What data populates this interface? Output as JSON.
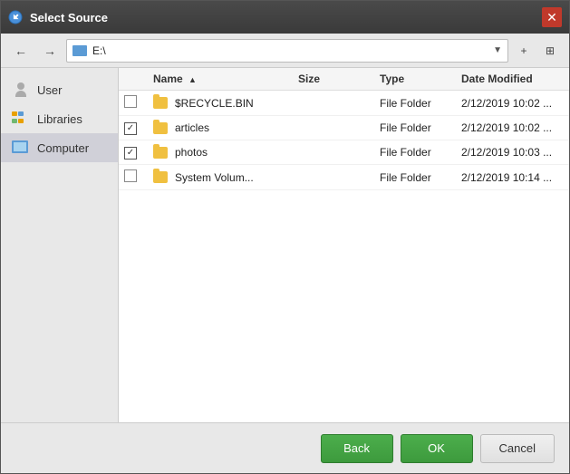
{
  "titleBar": {
    "title": "Select Source",
    "closeLabel": "✕"
  },
  "toolbar": {
    "backLabel": "←",
    "forwardLabel": "→",
    "addressText": "E:\\",
    "dropdownLabel": "▼",
    "newFolderLabel": "+",
    "viewLabel": "⊞"
  },
  "sidebar": {
    "items": [
      {
        "id": "user",
        "label": "User",
        "iconType": "user"
      },
      {
        "id": "libraries",
        "label": "Libraries",
        "iconType": "libraries"
      },
      {
        "id": "computer",
        "label": "Computer",
        "iconType": "computer"
      }
    ]
  },
  "fileTable": {
    "columns": [
      {
        "id": "checkbox",
        "label": ""
      },
      {
        "id": "name",
        "label": "Name",
        "sortArrow": "▲"
      },
      {
        "id": "size",
        "label": "Size"
      },
      {
        "id": "type",
        "label": "Type"
      },
      {
        "id": "dateModified",
        "label": "Date Modified"
      }
    ],
    "rows": [
      {
        "id": 1,
        "checked": false,
        "name": "$RECYCLE.BIN",
        "size": "",
        "type": "File Folder",
        "dateModified": "2/12/2019 10:02 ..."
      },
      {
        "id": 2,
        "checked": true,
        "name": "articles",
        "size": "",
        "type": "File Folder",
        "dateModified": "2/12/2019 10:02 ..."
      },
      {
        "id": 3,
        "checked": true,
        "name": "photos",
        "size": "",
        "type": "File Folder",
        "dateModified": "2/12/2019 10:03 ..."
      },
      {
        "id": 4,
        "checked": false,
        "name": "System Volum...",
        "size": "",
        "type": "File Folder",
        "dateModified": "2/12/2019 10:14 ..."
      }
    ]
  },
  "buttons": {
    "back": "Back",
    "ok": "OK",
    "cancel": "Cancel"
  }
}
